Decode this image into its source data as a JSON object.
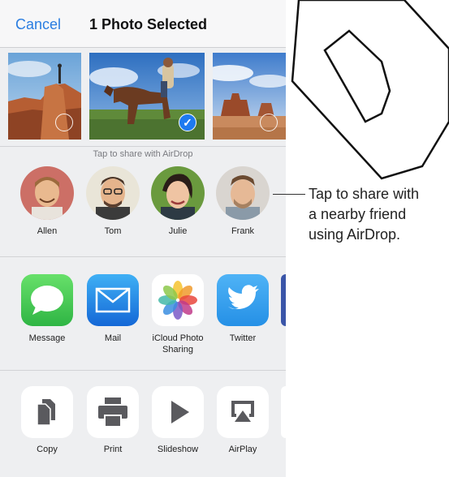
{
  "header": {
    "cancel_label": "Cancel",
    "title": "1 Photo Selected"
  },
  "photos": [
    {
      "name": "canyon-hiker-photo",
      "selected": false
    },
    {
      "name": "horse-rider-photo",
      "selected": true
    },
    {
      "name": "monument-valley-photo",
      "selected": false
    }
  ],
  "airdrop": {
    "hint": "Tap to share with AirDrop",
    "people": [
      {
        "name": "Allen"
      },
      {
        "name": "Tom"
      },
      {
        "name": "Julie"
      },
      {
        "name": "Frank"
      }
    ]
  },
  "apps": [
    {
      "label": "Message",
      "icon": "message-icon"
    },
    {
      "label": "Mail",
      "icon": "mail-icon"
    },
    {
      "label": "iCloud Photo\nSharing",
      "icon": "photos-icon"
    },
    {
      "label": "Twitter",
      "icon": "twitter-icon"
    }
  ],
  "actions": [
    {
      "label": "Copy",
      "icon": "copy-icon"
    },
    {
      "label": "Print",
      "icon": "print-icon"
    },
    {
      "label": "Slideshow",
      "icon": "play-icon"
    },
    {
      "label": "AirPlay",
      "icon": "airplay-icon"
    }
  ],
  "callout": {
    "line1": "Tap to share with",
    "line2": "a nearby friend",
    "line3": "using AirDrop."
  },
  "colors": {
    "accent": "#2a7de1",
    "check": "#1e7af0",
    "sheet_bg": "#eeeff1"
  }
}
